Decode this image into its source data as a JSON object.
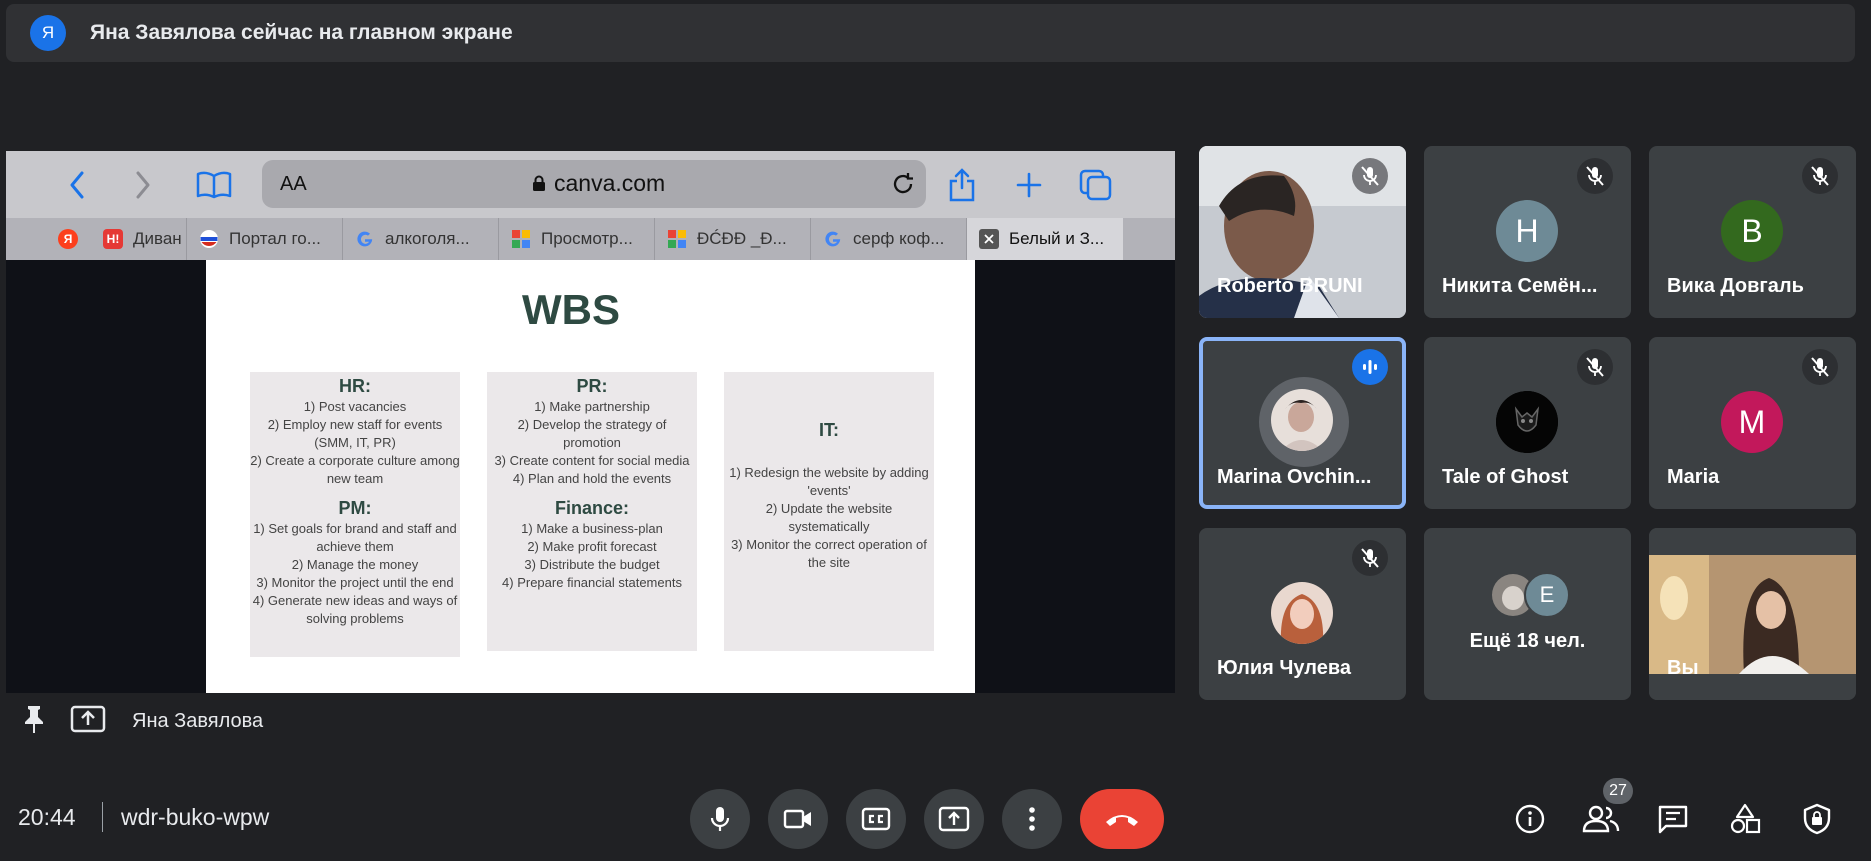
{
  "banner": {
    "avatar_letter": "Я",
    "text": "Яна Завялова сейчас на главном экране"
  },
  "browser": {
    "text_size_label": "AA",
    "host": "canva.com",
    "tabs": [
      "",
      "Диван",
      "Портал го...",
      "алкоголя...",
      "Просмотр...",
      "ĐĆĐĐ _Đ...",
      "серф коф...",
      "Белый и З..."
    ],
    "tab_favicon_labels": [
      "Я",
      "Н!"
    ]
  },
  "slide": {
    "title": "WBS",
    "hr_heading": "HR:",
    "hr_items": [
      "1) Post vacancies",
      "2) Employ new staff for events (SMM, IT, PR)",
      "2) Create a corporate culture among new team"
    ],
    "pm_heading": "PM:",
    "pm_items": [
      "1) Set goals for brand and staff and achieve them",
      "2) Manage the money",
      "3) Monitor the project until the end",
      "4) Generate new ideas and ways of solving problems"
    ],
    "pr_heading": "PR:",
    "pr_items": [
      "1) Make partnership",
      "2) Develop the strategy of promotion",
      "3) Create content for social media",
      "4) Plan and hold the events"
    ],
    "finance_heading": "Finance:",
    "finance_items": [
      "1) Make a business-plan",
      "2) Make profit forecast",
      "3) Distribute the budget",
      "4) Prepare financial statements"
    ],
    "it_heading": "IT:",
    "it_items": [
      "1) Redesign the website by adding 'events'",
      "2) Update the website systematically",
      "3) Monitor the correct operation of the site"
    ]
  },
  "presenter": {
    "name": "Яна Завялова"
  },
  "participants": [
    {
      "name": "Roberto BRUNI"
    },
    {
      "name": "Никита Семён...",
      "letter": "Н",
      "color": "#6e8a96"
    },
    {
      "name": "Вика Довгаль",
      "letter": "В",
      "color": "#33691e"
    },
    {
      "name": "Marina Ovchin..."
    },
    {
      "name": "Tale of Ghost"
    },
    {
      "name": "Maria",
      "letter": "M",
      "color": "#c2185b"
    },
    {
      "name": "Юлия Чулева"
    },
    {
      "name": "Ещё 18 чел.",
      "letter": "E",
      "color": "#6e8a96"
    },
    {
      "name": "Вы"
    }
  ],
  "bottom_bar": {
    "time": "20:44",
    "meeting_code": "wdr-buko-wpw",
    "participants_count": "27"
  },
  "colors": {
    "background": "#202124",
    "tile": "#3c4043",
    "accent": "#8ab4f8",
    "end_call": "#ea4335",
    "speaking": "#1a73e8"
  }
}
